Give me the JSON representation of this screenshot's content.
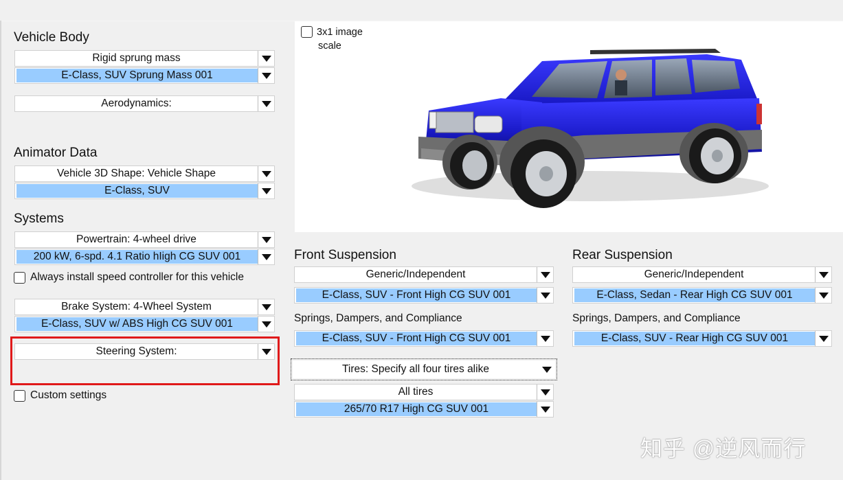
{
  "vehicle_body": {
    "heading": "Vehicle Body",
    "sprung_mass_type": "Rigid sprung mass",
    "sprung_mass_dataset": "E-Class, SUV Sprung Mass 001",
    "aerodynamics": "Aerodynamics:"
  },
  "animator": {
    "heading": "Animator Data",
    "shape_type": "Vehicle 3D Shape: Vehicle Shape",
    "shape_dataset": "E-Class, SUV"
  },
  "systems": {
    "heading": "Systems",
    "powertrain_type": "Powertrain: 4-wheel drive",
    "powertrain_dataset": "200 kW, 6-spd. 4.1 Ratio hIigh CG SUV 001",
    "speed_controller_label": "Always install speed controller for this vehicle",
    "brake_type": "Brake System: 4-Wheel System",
    "brake_dataset": "E-Class, SUV w/ ABS High CG SUV 001",
    "steering_type": "Steering System:",
    "custom_settings_label": "Custom settings"
  },
  "viewer": {
    "scale_line1": "3x1 image",
    "scale_line2": "scale",
    "vehicle_color": "#1b1bc9"
  },
  "front_suspension": {
    "heading": "Front Suspension",
    "type": "Generic/Independent",
    "dataset": "E-Class, SUV - Front High CG SUV 001",
    "compliance_label": "Springs, Dampers, and Compliance",
    "compliance_dataset": "E-Class, SUV - Front High CG SUV 001"
  },
  "rear_suspension": {
    "heading": "Rear Suspension",
    "type": "Generic/Independent",
    "dataset": "E-Class, Sedan - Rear High CG SUV 001",
    "compliance_label": "Springs, Dampers, and Compliance",
    "compliance_dataset": "E-Class, SUV - Rear High CG SUV 001"
  },
  "tires": {
    "mode": "Tires: Specify all four tires alike",
    "scope": "All tires",
    "dataset": "265/70 R17 High CG SUV 001"
  },
  "watermark": "知乎 @逆风而行",
  "colors": {
    "selected_bg": "#99ccff",
    "highlight_border": "#e0191a"
  }
}
